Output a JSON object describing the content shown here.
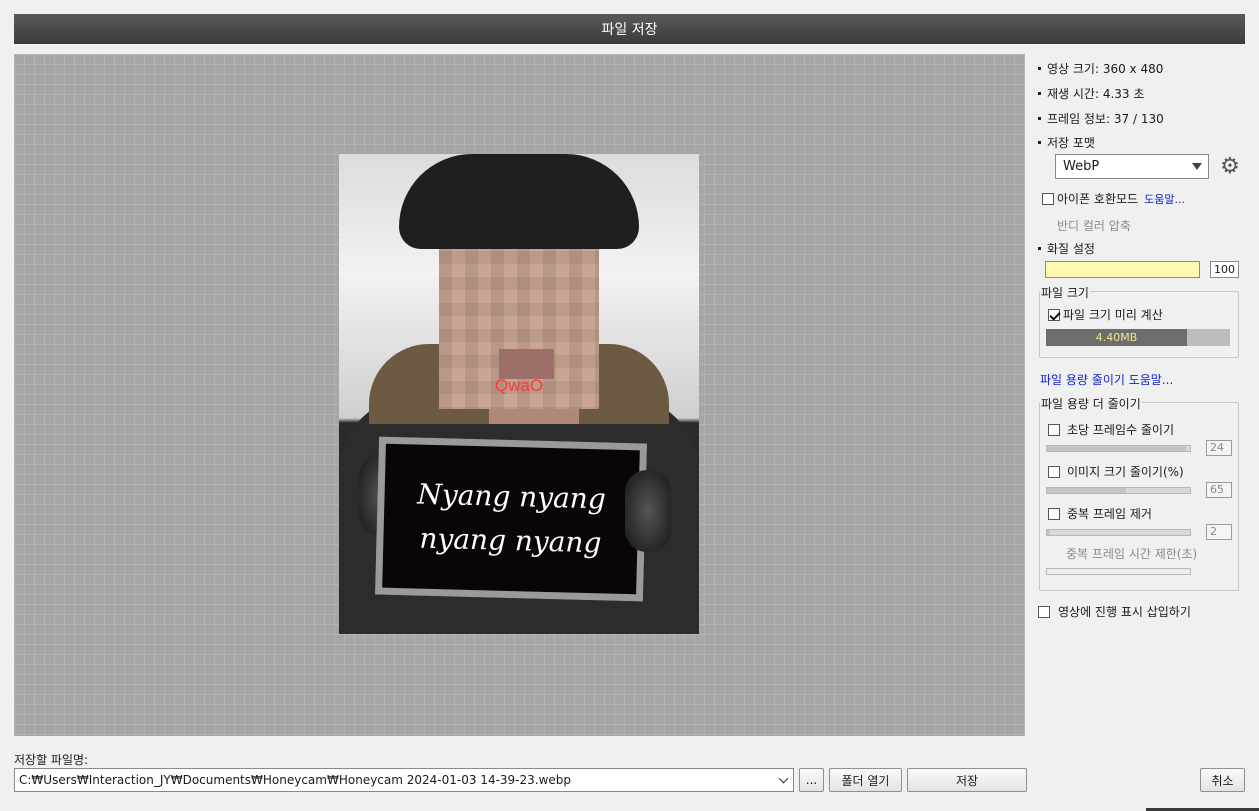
{
  "window": {
    "title": "파일 저장"
  },
  "info": {
    "video_size": "영상 크기: 360 x 480",
    "play_time": "재생 시간: 4.33 초",
    "frame_info": "프레임 정보: 37 / 130",
    "save_format_label": "저장 포맷"
  },
  "format": {
    "selected": "WebP",
    "icon": "gear-icon"
  },
  "iphone_mode": {
    "label": "아이폰 호환모드",
    "help": "도움말...",
    "checked": false
  },
  "dither_label": "반디 컬러 압축",
  "quality": {
    "label": "화질 설정",
    "value": "100"
  },
  "file_size": {
    "group_title": "파일 크기",
    "precalc_label": "파일 크기 미리 계산",
    "precalc_checked": true,
    "size_text": "4.40MB"
  },
  "reduce_help_link": "파일 용량 줄이기 도움말...",
  "reduce_more": {
    "group_title": "파일 용량 더 줄이기",
    "fps": {
      "label": "초당 프레임수 줄이기",
      "value": "24",
      "checked": false,
      "level": 0.97
    },
    "resize": {
      "label": "이미지 크기 줄이기(%)",
      "value": "65",
      "checked": false,
      "level": 0.55
    },
    "dedupe": {
      "label": "중복 프레임 제거",
      "value": "2",
      "checked": false,
      "level": 0.02
    },
    "dedupe_time_label": "중복 프레임 시간 제한(초)"
  },
  "progress_overlay": {
    "label": "영상에 진행 표시 삽입하기",
    "checked": false
  },
  "preview": {
    "sticker_text": "QwaO",
    "sign_line1": "Nyang nyang",
    "sign_line2": "nyang nyang"
  },
  "bottom": {
    "filename_label": "저장할 파일명:",
    "path": "C:₩Users₩Interaction_JY₩Documents₩Honeycam₩Honeycam 2024-01-03 14-39-23.webp",
    "browse_label": "...",
    "open_folder_label": "폴더 열기",
    "save_label": "저장",
    "cancel_label": "취소"
  }
}
